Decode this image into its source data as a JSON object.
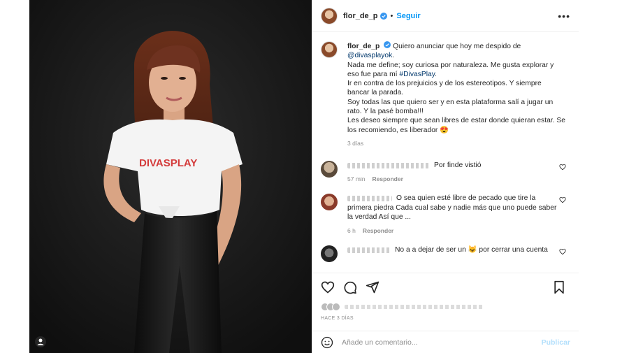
{
  "post": {
    "username": "flor_de_p",
    "follow_label": "Seguir",
    "more_icon": "more-horizontal-icon",
    "photo_shirt_text": "DIVASPLAY"
  },
  "caption": {
    "username": "flor_de_p",
    "line1": "Quiero anunciar que hoy me despido de",
    "mention": "@divasplayok",
    "mention_tail": ".",
    "p2_pre": "Nada me define; soy curiosa por naturaleza. Me gusta explorar y eso fue para mí ",
    "hashtag": "#DivasPlay",
    "p2_tail": ".",
    "p3": "Ir en contra de los prejuicios y de los estereotipos. Y siempre bancar la parada.",
    "p4": "Soy todas las que quiero ser y en esta plataforma salí a jugar un rato. Y la pasé bomba!!!",
    "p5": "Les deseo siempre que sean libres de estar donde quieran estar. Se los recomiendo, es liberador 😍",
    "time": "3 días"
  },
  "comments": [
    {
      "text": "Por finde vistió",
      "time": "57 min",
      "reply": "Responder"
    },
    {
      "text": "O sea quien esté libre de pecado que tire la primera piedra Cada cual sabe y nadie más que uno puede saber la verdad Así que ...",
      "time": "6 h",
      "reply": "Responder"
    },
    {
      "text": "No a a dejar de ser un 😺 por cerrar una cuenta"
    }
  ],
  "footer": {
    "date": "Hace 3 días",
    "comment_placeholder": "Añade un comentario...",
    "publish_label": "Publicar"
  },
  "colors": {
    "link_blue": "#0095f6",
    "publish_disabled": "#b2dffc",
    "secondary_text": "#8e8e8e"
  }
}
